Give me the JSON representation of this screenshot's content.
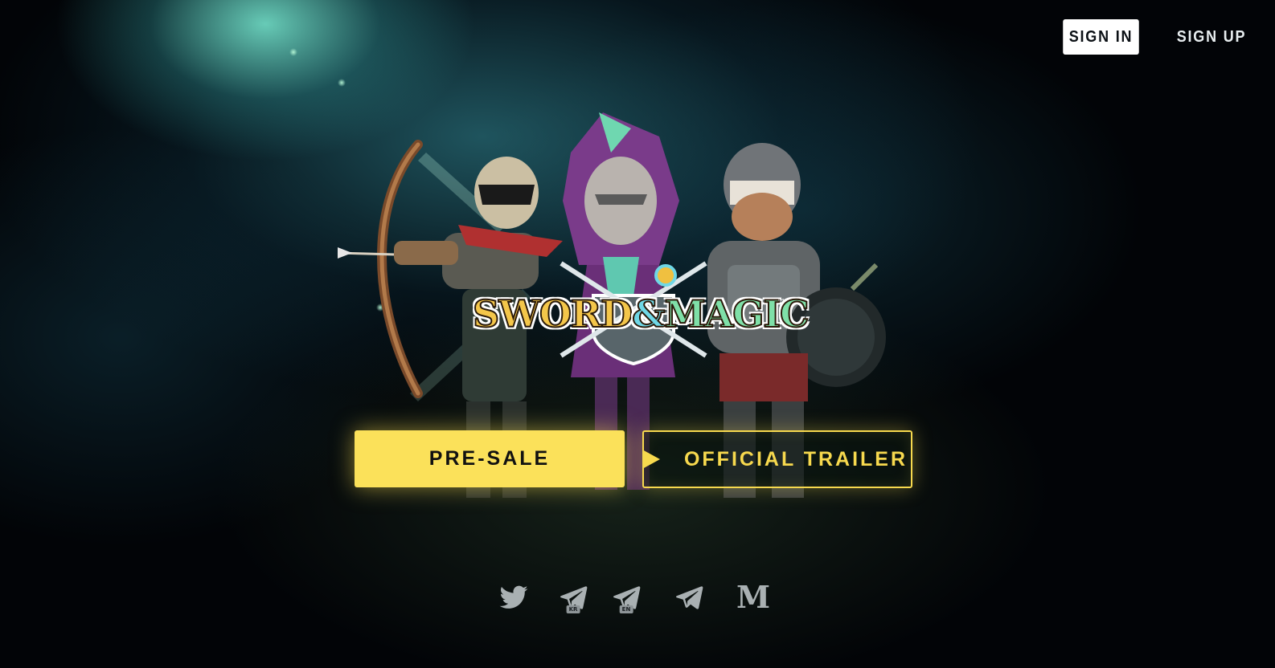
{
  "header": {
    "sign_in_label": "SIGN IN",
    "sign_up_label": "SIGN UP"
  },
  "hero": {
    "logo_text_sword": "SWORD",
    "logo_text_amp": "&",
    "logo_text_magic": "MAGIC",
    "logo_trademark": "™"
  },
  "cta": {
    "presale_label": "PRE-SALE",
    "trailer_label": "OFFICIAL TRAILER"
  },
  "socials": {
    "items": [
      {
        "icon": "twitter-icon"
      },
      {
        "icon": "telegram-kr-icon",
        "badge": "KR"
      },
      {
        "icon": "telegram-en-icon",
        "badge": "EN"
      },
      {
        "icon": "telegram-icon"
      },
      {
        "icon": "medium-icon",
        "glyph": "M"
      }
    ]
  },
  "colors": {
    "accent_yellow": "#fbe15a",
    "background": "#020407",
    "teal_glow": "#6fe3cf",
    "icon_gray": "#a9b0b2"
  }
}
